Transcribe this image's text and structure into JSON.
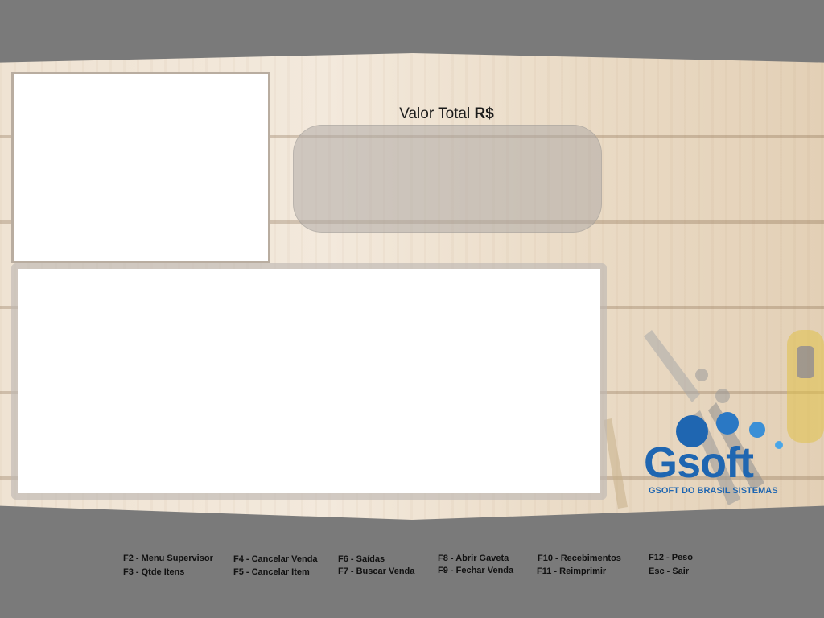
{
  "valor_total": {
    "label": "Valor Total",
    "currency": "R$"
  },
  "logo": {
    "name_g": "G",
    "name_rest": "soft",
    "tagline": "GSOFT DO BRASIL SISTEMAS"
  },
  "colors": {
    "frame_gray": "#7a7a7a",
    "brand_blue": "#1f66b1"
  },
  "shortcuts": [
    {
      "label": "F2 - Menu Supervisor"
    },
    {
      "label": "F3 - Qtde Itens"
    },
    {
      "label": "F4 - Cancelar Venda"
    },
    {
      "label": "F5 - Cancelar Item"
    },
    {
      "label": "F6 - Saídas"
    },
    {
      "label": "F7 - Buscar Venda"
    },
    {
      "label": "F8 - Abrir Gaveta"
    },
    {
      "label": "F9 - Fechar Venda"
    },
    {
      "label": "F10 - Recebimentos"
    },
    {
      "label": "F11 - Reimprimir"
    },
    {
      "label": "F12 - Peso"
    },
    {
      "label": "Esc - Sair"
    }
  ]
}
